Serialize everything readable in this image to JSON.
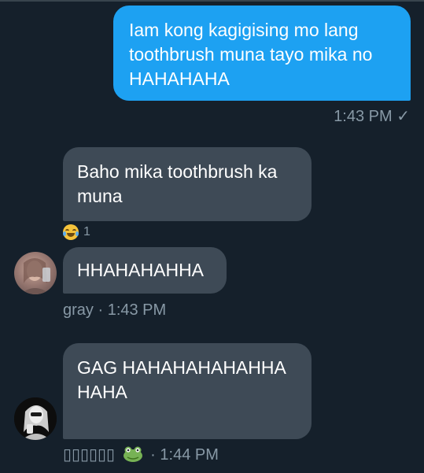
{
  "messages": {
    "sent": {
      "text": "Iam kong kagigising mo lang toothbrush muna tayo mika no HAHAHAHA",
      "time": "1:43 PM",
      "status": "✓"
    },
    "received1": {
      "text": "Baho mika toothbrush ka muna",
      "reaction": {
        "emoji": "face-with-tears-of-joy",
        "count": "1"
      }
    },
    "received2": {
      "text": "HHAHAHAHHA",
      "sender": "gray",
      "separator": "·",
      "time": "1:43 PM"
    },
    "received3": {
      "text": "GAG HAHAHAHAHAHHAHAHA",
      "sender": "▯▯▯▯▯▯",
      "separator": "·",
      "time": "1:44 PM"
    }
  },
  "colors": {
    "background": "#15202b",
    "outgoing_bubble": "#1da1f2",
    "incoming_bubble": "#3e4a56",
    "meta_text": "#8899a6"
  }
}
